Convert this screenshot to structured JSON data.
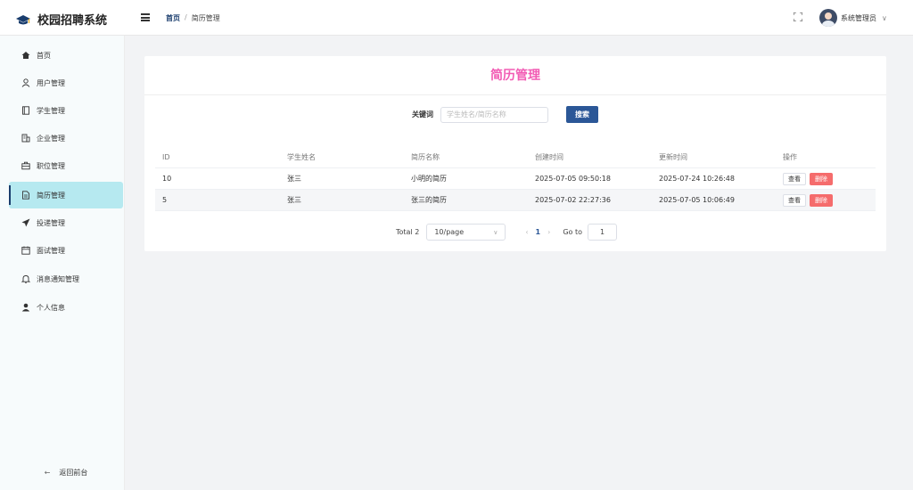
{
  "app": {
    "title": "校园招聘系统"
  },
  "header": {
    "breadcrumb": {
      "home": "首页",
      "separator": "/",
      "current": "简历管理"
    },
    "user_name": "系统管理员"
  },
  "sidebar": {
    "items": [
      {
        "label": "首页",
        "icon": "home-icon"
      },
      {
        "label": "用户管理",
        "icon": "user-icon"
      },
      {
        "label": "学生管理",
        "icon": "book-icon"
      },
      {
        "label": "企业管理",
        "icon": "building-icon"
      },
      {
        "label": "职位管理",
        "icon": "briefcase-icon"
      },
      {
        "label": "简历管理",
        "icon": "document-icon",
        "active": true
      },
      {
        "label": "投递管理",
        "icon": "send-icon"
      },
      {
        "label": "面试管理",
        "icon": "calendar-icon"
      },
      {
        "label": "消息通知管理",
        "icon": "bell-icon"
      },
      {
        "label": "个人信息",
        "icon": "person-icon"
      }
    ],
    "back_label": "返回前台"
  },
  "main": {
    "title": "简历管理",
    "search": {
      "label": "关键词",
      "placeholder": "学生姓名/简历名称",
      "button": "搜索"
    },
    "table": {
      "columns": [
        "ID",
        "学生姓名",
        "简历名称",
        "创建时间",
        "更新时间",
        "操作"
      ],
      "rows": [
        {
          "id": "10",
          "student": "张三",
          "resume": "小明的简历",
          "created": "2025-07-05 09:50:18",
          "updated": "2025-07-24 10:26:48"
        },
        {
          "id": "5",
          "student": "张三",
          "resume": "张三的简历",
          "created": "2025-07-02 22:27:36",
          "updated": "2025-07-05 10:06:49"
        }
      ],
      "actions": {
        "view": "查看",
        "delete": "删除"
      }
    },
    "pagination": {
      "total": "Total 2",
      "page_size": "10/page",
      "current_page": "1",
      "goto_label": "Go to",
      "goto_value": "1"
    }
  },
  "colors": {
    "accent": "#1a3d6d",
    "title_pink": "#f25cb4",
    "active_bg": "#b6e9f0",
    "danger": "#f56c6c",
    "primary_btn": "#2b5797"
  }
}
